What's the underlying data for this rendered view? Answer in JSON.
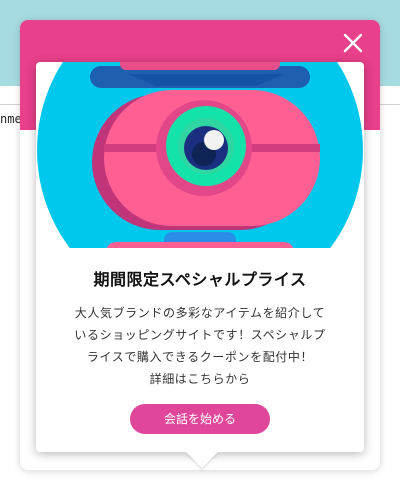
{
  "background": {
    "partial_text": "nme"
  },
  "dialog": {
    "close_icon": "close-icon",
    "header_color": "#e8408a",
    "title": "期間限定スペシャルプライス",
    "description_lines": [
      "大人気ブランドの多彩なアイテムを紹介して",
      "いるショッピングサイトです！スペシャルプ",
      "ライスで購入できるクーポンを配付中！",
      "詳細はこちらから"
    ],
    "cta_label": "会話を始める",
    "cta_color": "#e0479a"
  }
}
